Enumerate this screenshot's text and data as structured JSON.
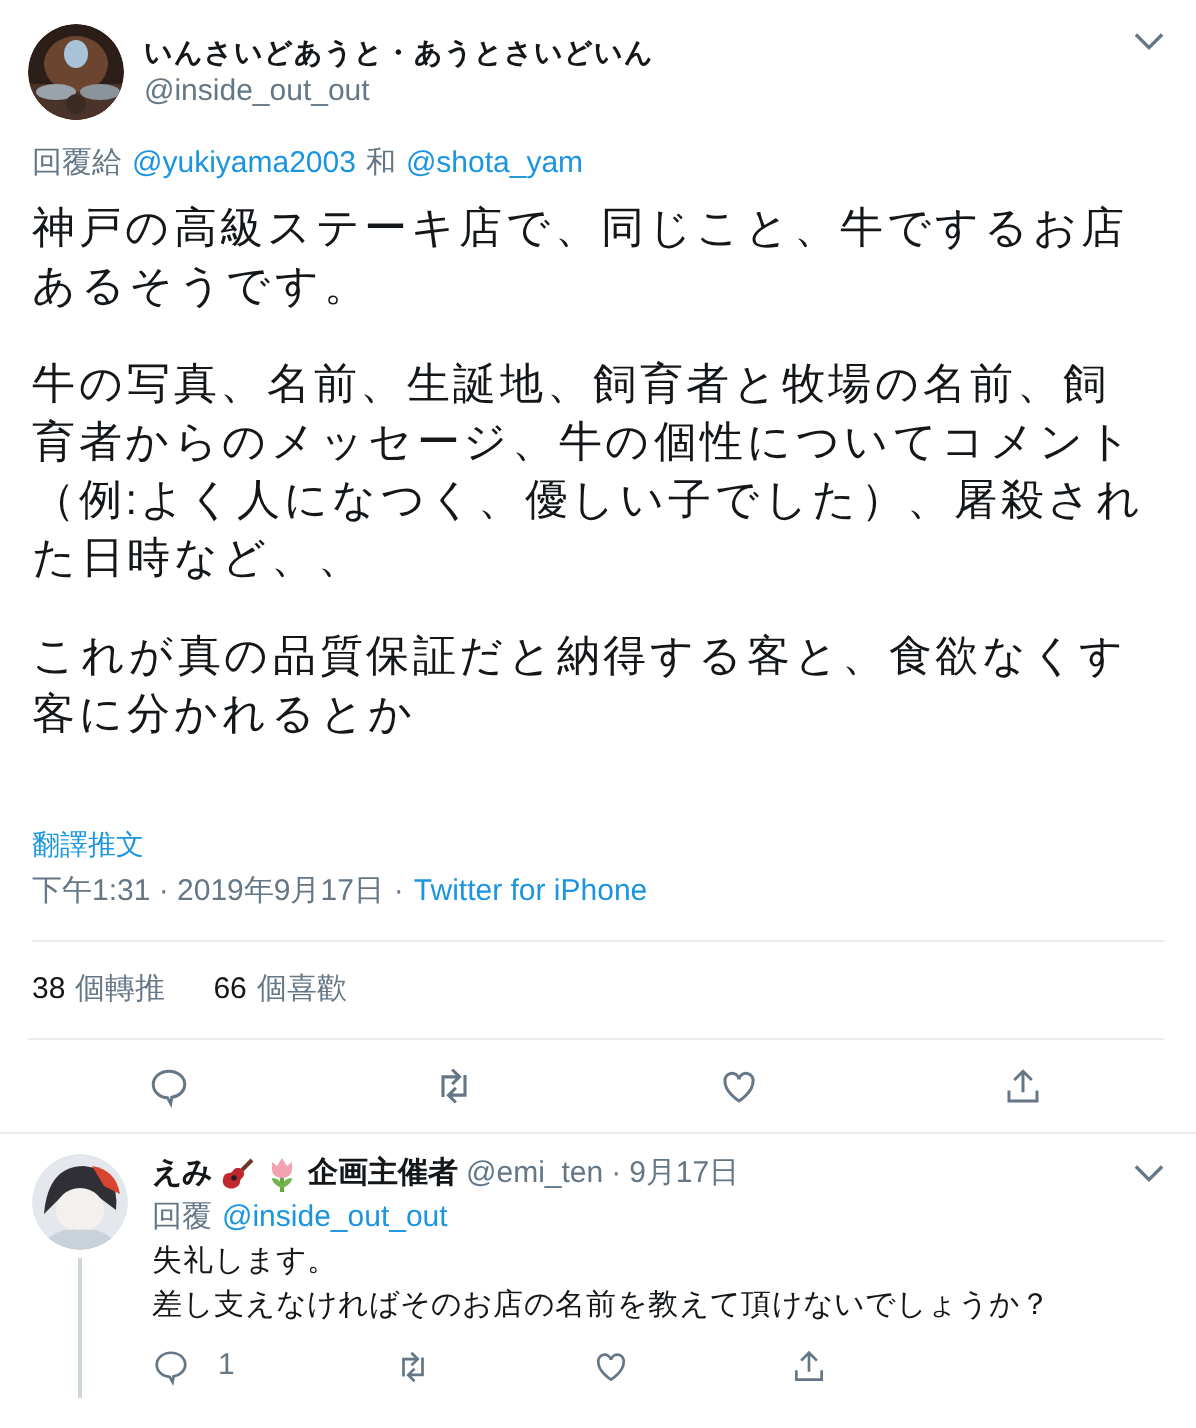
{
  "tweet": {
    "author": {
      "name": "いんさいどあうと・あうとさいどいん",
      "handle": "@inside_out_out"
    },
    "reply_to": {
      "label": "回覆給",
      "users": [
        "@yukiyama2003",
        "@shota_yam"
      ],
      "joiner": "和"
    },
    "paragraphs": [
      "神戸の高級ステーキ店で、同じこと、牛でするお店あるそうです。",
      "牛の写真、名前、生誕地、飼育者と牧場の名前、飼育者からのメッセージ、牛の個性についてコメント（例:よく人になつく、優しい子でした）、屠殺された日時など、、",
      "これが真の品質保証だと納得する客と、食欲なくす客に分かれるとか"
    ],
    "translate": "翻譯推文",
    "time": "下午1:31 · 2019年9月17日",
    "separator": "·",
    "source": "Twitter for iPhone",
    "stats": [
      {
        "count": "38",
        "label": "個轉推"
      },
      {
        "count": "66",
        "label": "個喜歡"
      }
    ]
  },
  "reply": {
    "name": "えみ",
    "name_suffix": "企画主催者",
    "handle": "@emi_ten",
    "date": "9月17日",
    "reply_label": "回覆",
    "reply_user": "@inside_out_out",
    "lines": [
      "失礼します。",
      "差し支えなければそのお店の名前を教えて頂けないでしょうか？"
    ],
    "reply_count": "1"
  }
}
